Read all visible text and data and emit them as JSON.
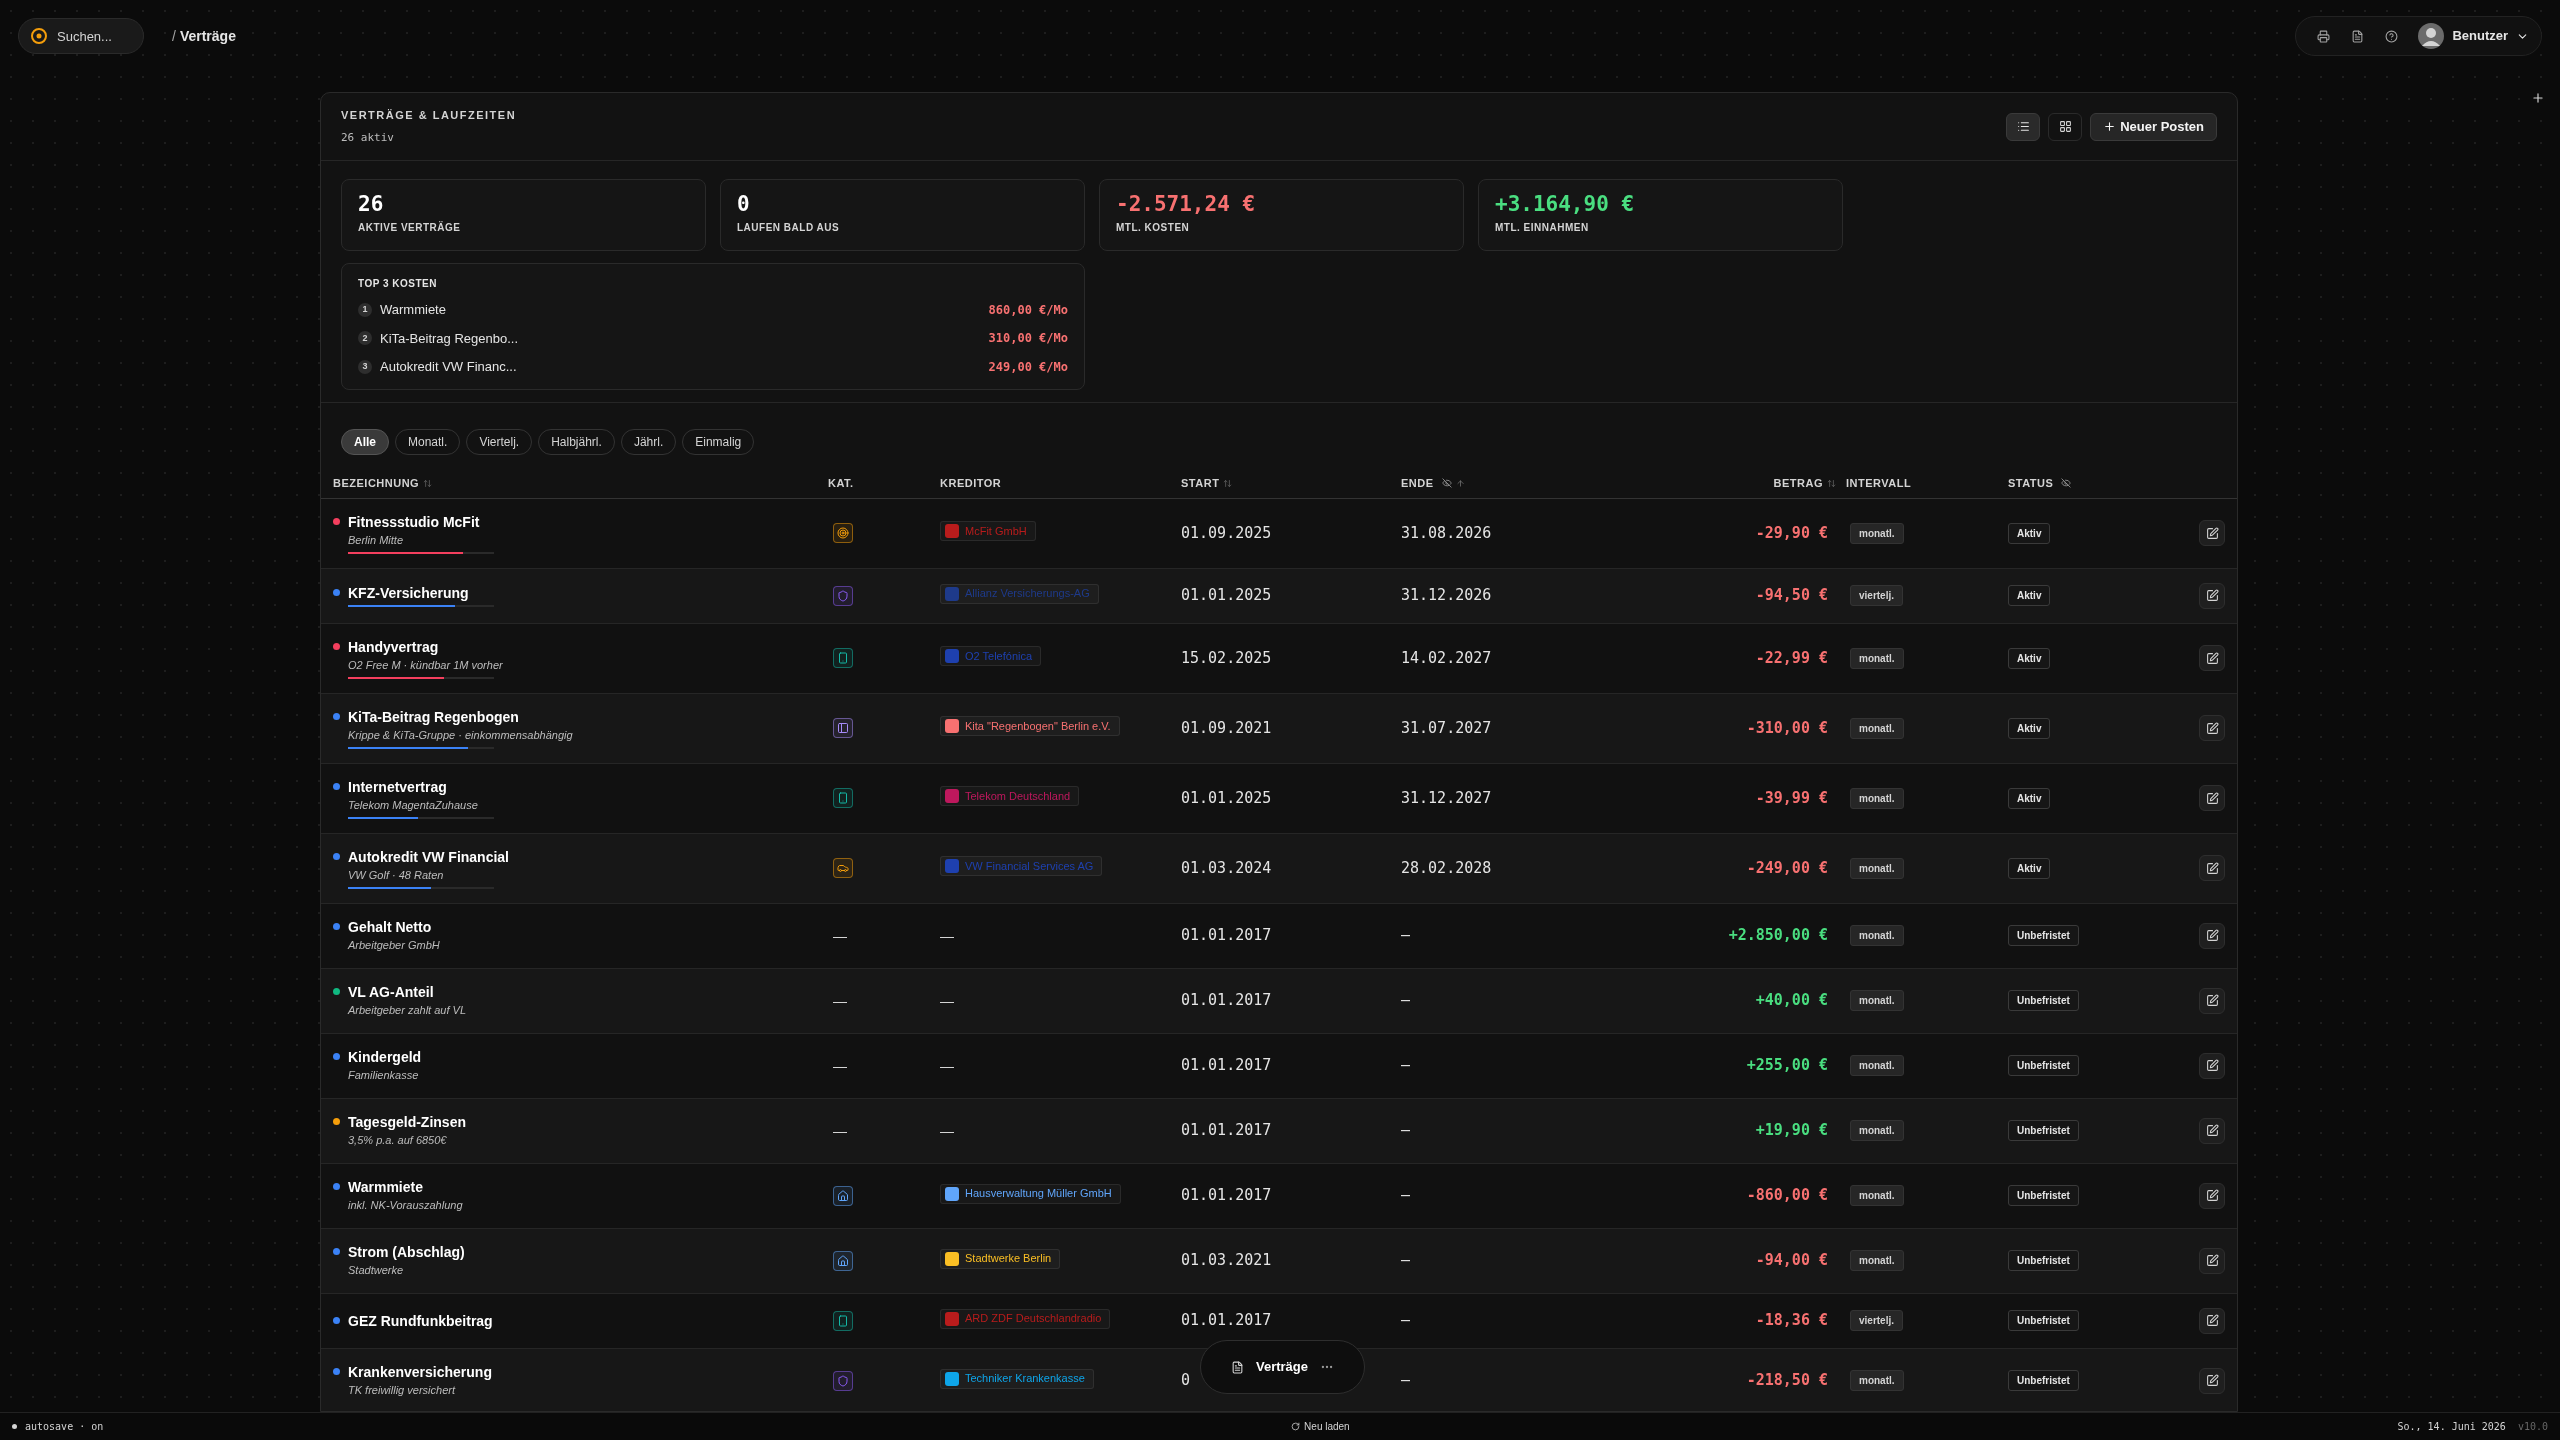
{
  "topbar": {
    "search": {
      "placeholder": "Suchen..."
    },
    "breadcrumb": {
      "separator": "/",
      "current": "Verträge"
    },
    "user": {
      "name": "Benutzer"
    }
  },
  "panel": {
    "title": "VERTRÄGE & LAUFZEITEN",
    "subtitle": "26 aktiv",
    "new_button": "Neuer Posten",
    "stats": [
      {
        "value": "26",
        "label": "AKTIVE VERTRÄGE",
        "color": "#ffffff"
      },
      {
        "value": "0",
        "label": "LAUFEN BALD AUS",
        "color": "#ffffff"
      },
      {
        "value": "-2.571,24 €",
        "label": "MTL. KOSTEN",
        "color": "#f87171"
      },
      {
        "value": "+3.164,90 €",
        "label": "MTL. EINNAHMEN",
        "color": "#4ade80"
      }
    ],
    "top_costs": {
      "title": "TOP 3 KOSTEN",
      "items": [
        {
          "rank": "1",
          "name": "Warmmiete",
          "amount": "860,00 €/Mo"
        },
        {
          "rank": "2",
          "name": "KiTa-Beitrag Regenbo...",
          "amount": "310,00 €/Mo"
        },
        {
          "rank": "3",
          "name": "Autokredit VW Financ...",
          "amount": "249,00 €/Mo"
        }
      ]
    },
    "filters": [
      {
        "label": "Alle",
        "selected": true
      },
      {
        "label": "Monatl.",
        "selected": false
      },
      {
        "label": "Viertelj.",
        "selected": false
      },
      {
        "label": "Halbjährl.",
        "selected": false
      },
      {
        "label": "Jährl.",
        "selected": false
      },
      {
        "label": "Einmalig",
        "selected": false
      }
    ],
    "columns": [
      "BEZEICHNUNG",
      "KAT.",
      "KREDITOR",
      "START",
      "ENDE",
      "BETRAG",
      "INTERVALL",
      "STATUS"
    ],
    "rows": [
      {
        "name": "Fitnessstudio McFit",
        "subtitle": "Berlin Mitte",
        "color": "#f43f5e",
        "level": 0.79,
        "category": {
          "kind": "target"
        },
        "creditor": {
          "kind": "badge",
          "name": "McFit GmbH",
          "color": "#b91c1c"
        },
        "start": "01.09.2025",
        "end": "31.08.2026",
        "amount": "-29,90 €",
        "kind": "expense",
        "interval": "monatl.",
        "status": "Aktiv"
      },
      {
        "name": "KFZ-Versicherung",
        "color": "#3b82f6",
        "level": 0.73,
        "category": {
          "kind": "shield"
        },
        "creditor": {
          "kind": "badge",
          "name": "Allianz Versicherungs-AG",
          "color": "#1e3a8a"
        },
        "start": "01.01.2025",
        "end": "31.12.2026",
        "amount": "-94,50 €",
        "kind": "expense",
        "interval": "viertelj.",
        "status": "Aktiv"
      },
      {
        "name": "Handyvertrag",
        "subtitle": "O2 Free M · kündbar 1M vorher",
        "color": "#f43f5e",
        "level": 0.66,
        "category": {
          "kind": "phone"
        },
        "creditor": {
          "kind": "badge",
          "name": "O2 Telefónica",
          "color": "#1e40af"
        },
        "start": "15.02.2025",
        "end": "14.02.2027",
        "amount": "-22,99 €",
        "kind": "expense",
        "interval": "monatl.",
        "status": "Aktiv"
      },
      {
        "name": "KiTa-Beitrag Regenbogen",
        "subtitle": "Krippe & KiTa-Gruppe · einkommensabhängig",
        "color": "#3b82f6",
        "level": 0.82,
        "category": {
          "kind": "book"
        },
        "creditor": {
          "kind": "badge",
          "name": "Kita \"Regenbogen\" Berlin e.V.",
          "color": "#f87171"
        },
        "start": "01.09.2021",
        "end": "31.07.2027",
        "amount": "-310,00 €",
        "kind": "expense",
        "interval": "monatl.",
        "status": "Aktiv"
      },
      {
        "name": "Internetvertrag",
        "subtitle": "Telekom MagentaZuhause",
        "color": "#3b82f6",
        "level": 0.48,
        "category": {
          "kind": "phone"
        },
        "creditor": {
          "kind": "badge",
          "name": "Telekom Deutschland",
          "color": "#be185d"
        },
        "start": "01.01.2025",
        "end": "31.12.2027",
        "amount": "-39,99 €",
        "kind": "expense",
        "interval": "monatl.",
        "status": "Aktiv"
      },
      {
        "name": "Autokredit VW Financial",
        "subtitle": "VW Golf · 48 Raten",
        "color": "#3b82f6",
        "level": 0.57,
        "category": {
          "kind": "car"
        },
        "creditor": {
          "kind": "badge",
          "name": "VW Financial Services AG",
          "color": "#1e40af"
        },
        "start": "01.03.2024",
        "end": "28.02.2028",
        "amount": "-249,00 €",
        "kind": "expense",
        "interval": "monatl.",
        "status": "Aktiv"
      },
      {
        "name": "Gehalt Netto",
        "subtitle": "Arbeitgeber GmbH",
        "color": "#3b82f6",
        "category": {
          "kind": "empty",
          "text": "—"
        },
        "creditor": {
          "kind": "empty",
          "text": "—"
        },
        "start": "01.01.2017",
        "end": "—",
        "amount": "+2.850,00 €",
        "kind": "income",
        "interval": "monatl.",
        "status": "Unbefristet"
      },
      {
        "name": "VL AG-Anteil",
        "subtitle": "Arbeitgeber zahlt auf VL",
        "color": "#10b981",
        "category": {
          "kind": "empty",
          "text": "—"
        },
        "creditor": {
          "kind": "empty",
          "text": "—"
        },
        "start": "01.01.2017",
        "end": "—",
        "amount": "+40,00 €",
        "kind": "income",
        "interval": "monatl.",
        "status": "Unbefristet"
      },
      {
        "name": "Kindergeld",
        "subtitle": "Familienkasse",
        "color": "#3b82f6",
        "category": {
          "kind": "empty",
          "text": "—"
        },
        "creditor": {
          "kind": "empty",
          "text": "—"
        },
        "start": "01.01.2017",
        "end": "—",
        "amount": "+255,00 €",
        "kind": "income",
        "interval": "monatl.",
        "status": "Unbefristet"
      },
      {
        "name": "Tagesgeld-Zinsen",
        "subtitle": "3,5% p.a. auf 6850€",
        "color": "#f59e0b",
        "category": {
          "kind": "empty",
          "text": "—"
        },
        "creditor": {
          "kind": "empty",
          "text": "—"
        },
        "start": "01.01.2017",
        "end": "—",
        "amount": "+19,90 €",
        "kind": "income",
        "interval": "monatl.",
        "status": "Unbefristet"
      },
      {
        "name": "Warmmiete",
        "subtitle": "inkl. NK-Vorauszahlung",
        "color": "#3b82f6",
        "category": {
          "kind": "home"
        },
        "creditor": {
          "kind": "badge",
          "name": "Hausverwaltung Müller GmbH",
          "color": "#60a5fa"
        },
        "start": "01.01.2017",
        "end": "—",
        "amount": "-860,00 €",
        "kind": "expense",
        "interval": "monatl.",
        "status": "Unbefristet"
      },
      {
        "name": "Strom (Abschlag)",
        "subtitle": "Stadtwerke",
        "color": "#3b82f6",
        "category": {
          "kind": "home"
        },
        "creditor": {
          "kind": "badge",
          "name": "Stadtwerke Berlin",
          "color": "#fbbf24"
        },
        "start": "01.03.2021",
        "end": "—",
        "amount": "-94,00 €",
        "kind": "expense",
        "interval": "monatl.",
        "status": "Unbefristet"
      },
      {
        "name": "GEZ Rundfunkbeitrag",
        "color": "#3b82f6",
        "category": {
          "kind": "phone"
        },
        "creditor": {
          "kind": "badge",
          "name": "ARD ZDF Deutschlandradio",
          "color": "#b91c1c"
        },
        "start": "01.01.2017",
        "end": "—",
        "amount": "-18,36 €",
        "kind": "expense",
        "interval": "viertelj.",
        "status": "Unbefristet"
      },
      {
        "name": "Krankenversicherung",
        "subtitle": "TK freiwillig versichert",
        "color": "#3b82f6",
        "category": {
          "kind": "shield"
        },
        "creditor": {
          "kind": "badge",
          "name": "Techniker Krankenkasse",
          "color": "#0ea5e9"
        },
        "start": "0",
        "end": "—",
        "amount": "-218,50 €",
        "kind": "expense",
        "interval": "monatl.",
        "status": "Unbefristet"
      }
    ]
  },
  "floating_nav": {
    "label": "Verträge"
  },
  "status_bar": {
    "autosave": "autosave · on",
    "reload": "Neu laden",
    "date": "So., 14. Juni 2026",
    "version": "v10.0"
  }
}
